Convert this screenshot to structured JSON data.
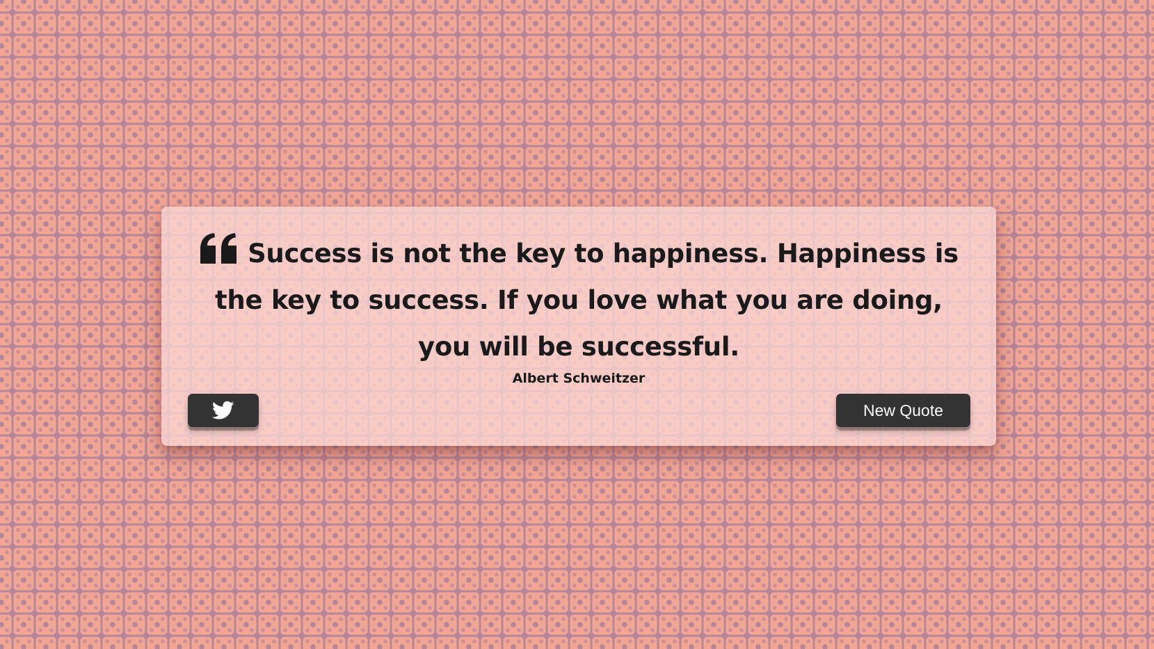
{
  "quote": {
    "text": "Success is not the key to happiness. Happiness is the key to success. If you love what you are doing, you will be successful.",
    "author": "Albert Schweitzer",
    "icon": "quote-left-icon"
  },
  "actions": {
    "tweet_icon": "twitter-icon",
    "new_quote_label": "New Quote"
  },
  "colors": {
    "background": "#f2a593",
    "pattern": "#b3869a",
    "card": "#fad6d4",
    "button": "#333333",
    "button_text": "#ffffff"
  }
}
